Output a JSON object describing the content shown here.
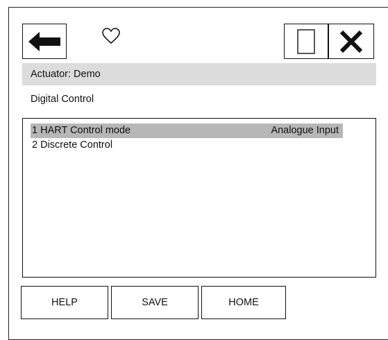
{
  "toolbar": {
    "back_icon": "arrow-left-icon",
    "favorite_icon": "heart-outline-icon",
    "window_icon": "rectangle-icon",
    "close_icon": "close-x-icon"
  },
  "header": {
    "actuator_label": "Actuator: Demo",
    "section_title": "Digital Control"
  },
  "menu": {
    "items": [
      {
        "label": "1 HART Control mode",
        "value": "Analogue Input",
        "selected": true
      },
      {
        "label": "2 Discrete Control",
        "value": "",
        "selected": false
      }
    ]
  },
  "buttons": {
    "help": "HELP",
    "save": "SAVE",
    "home": "HOME"
  },
  "colors": {
    "header_bg": "#dcdcdc",
    "selected_row_bg": "#b7b7b7",
    "border": "#111111"
  }
}
